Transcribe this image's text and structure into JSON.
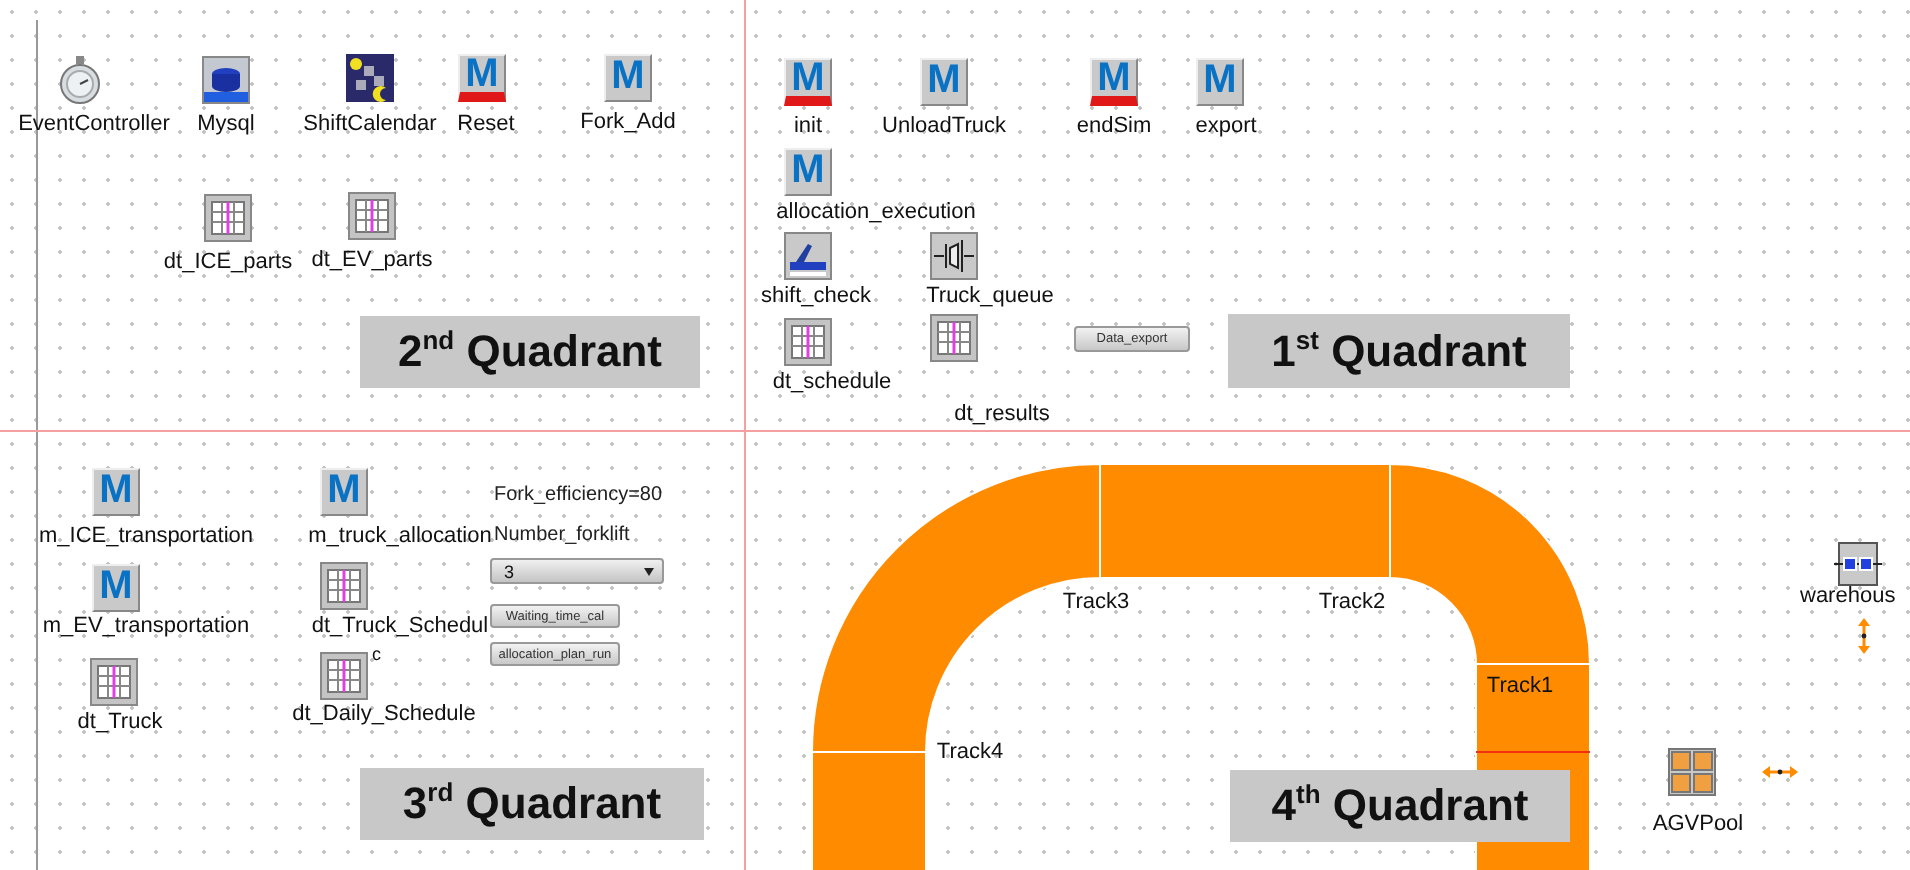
{
  "quadrants": [
    {
      "title": "2$^{nd}$ Quadrant",
      "objects": [
        {
          "kind": "clock",
          "label": "EventController"
        },
        {
          "kind": "database",
          "label": "Mysql"
        },
        {
          "kind": "calendar",
          "label": "ShiftCalendar"
        },
        {
          "kind": "method",
          "glyph": "M",
          "flagged": true,
          "label": "Reset"
        },
        {
          "kind": "method",
          "glyph": "M",
          "flagged": false,
          "label": "Fork_Add"
        },
        {
          "kind": "table",
          "label": "dt_ICE_parts"
        },
        {
          "kind": "table",
          "label": "dt_EV_parts"
        }
      ]
    },
    {
      "title": "1$^{st}$ Quadrant",
      "objects": [
        {
          "kind": "method",
          "glyph": "M",
          "flagged": true,
          "label": "init"
        },
        {
          "kind": "method",
          "glyph": "M",
          "flagged": false,
          "label": "UnloadTruck"
        },
        {
          "kind": "method",
          "glyph": "M",
          "flagged": true,
          "label": "endSim"
        },
        {
          "kind": "method",
          "glyph": "M",
          "flagged": false,
          "label": "export"
        },
        {
          "kind": "method",
          "glyph": "M",
          "flagged": false,
          "label": "allocation_execution"
        },
        {
          "kind": "shift",
          "label": "shift_check"
        },
        {
          "kind": "queue",
          "label": "Truck_queue"
        },
        {
          "kind": "button",
          "label": "Data_export"
        },
        {
          "kind": "table",
          "label": "dt_schedule"
        },
        {
          "kind": "table",
          "label": "dt_results"
        }
      ]
    },
    {
      "title": "3$^{rd}$ Quadrant",
      "objects": [
        {
          "kind": "method",
          "glyph": "M",
          "flagged": false,
          "label": "m_ICE_transportation"
        },
        {
          "kind": "method",
          "glyph": "M",
          "flagged": false,
          "label": "m_truck_allocation"
        },
        {
          "kind": "method",
          "glyph": "M",
          "flagged": false,
          "label": "m_EV_transportation"
        },
        {
          "kind": "table",
          "label": "dt_Truck_Schedul"
        },
        {
          "kind": "table",
          "label": "dt_Truck"
        },
        {
          "kind": "table",
          "label": "dt_Daily_Schedule",
          "badge": "c"
        },
        {
          "kind": "text",
          "label": "Fork_efficiency=80"
        },
        {
          "kind": "text",
          "label": "Number_forklift"
        },
        {
          "kind": "dropdown",
          "value": "3"
        },
        {
          "kind": "button",
          "label": "Waiting_time_cal"
        },
        {
          "kind": "button",
          "label": "allocation_plan_run"
        }
      ]
    },
    {
      "title": "4$^{th}$ Quadrant",
      "objects": [
        {
          "kind": "track",
          "label": "Track3"
        },
        {
          "kind": "track",
          "label": "Track2"
        },
        {
          "kind": "track",
          "label": "Track1"
        },
        {
          "kind": "track",
          "label": "Track4"
        },
        {
          "kind": "store",
          "label": "warehous"
        },
        {
          "kind": "pool",
          "label": "AGVPool"
        }
      ]
    }
  ]
}
